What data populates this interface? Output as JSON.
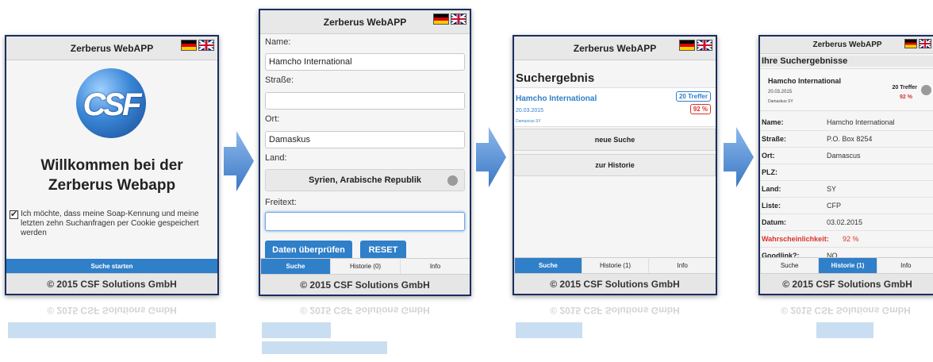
{
  "app": {
    "title": "Zerberus WebAPP",
    "copyright": "© 2015 CSF Solutions GmbH",
    "brand_color": "#2f7fc9",
    "frame_color": "#1b2f5e"
  },
  "screen1": {
    "logo_text": "CSF",
    "welcome": "Willkommen bei der Zerberus Webapp",
    "consent_text": "Ich möchte, dass meine Soap-Kennung und meine letzten zehn Suchanfragen per Cookie gespeichert werden",
    "consent_checked": true,
    "start_button": "Suche starten"
  },
  "screen2": {
    "fields": [
      {
        "label": "Name:",
        "value": "Hamcho International"
      },
      {
        "label": "Straße:",
        "value": ""
      },
      {
        "label": "Ort:",
        "value": "Damaskus"
      },
      {
        "label": "Land:",
        "value": "Syrien, Arabische Republik"
      },
      {
        "label": "Freitext:",
        "value": ""
      }
    ],
    "check_button": "Daten überprüfen",
    "reset_button": "RESET",
    "tabs": [
      "Suche",
      "Historie (0)",
      "Info"
    ]
  },
  "screen3": {
    "heading": "Suchergebnis",
    "result": {
      "name": "Hamcho International",
      "date": "20.03.2015",
      "location": "Damascus SY",
      "hits": "20 Treffer",
      "score": "92 %"
    },
    "new_search_button": "neue Suche",
    "history_button": "zur Historie",
    "tabs": [
      "Suche",
      "Historie (1)",
      "Info"
    ]
  },
  "screen4": {
    "heading": "Ihre Suchergebnisse",
    "summary": {
      "name": "Hamcho International",
      "date": "20.03.2015",
      "location": "Damaskus SY",
      "hits": "20 Treffer",
      "score": "92 %"
    },
    "details": [
      {
        "key": "Name:",
        "value": "Hamcho International"
      },
      {
        "key": "Straße:",
        "value": "P.O. Box 8254"
      },
      {
        "key": "Ort:",
        "value": "Damascus"
      },
      {
        "key": "PLZ:",
        "value": ""
      },
      {
        "key": "Land:",
        "value": "SY"
      },
      {
        "key": "Liste:",
        "value": "CFP"
      },
      {
        "key": "Datum:",
        "value": "03.02.2015"
      },
      {
        "key": "Wahrscheinlichkeit:",
        "value": "92 %"
      },
      {
        "key": "Goodlink?:",
        "value": "NO"
      }
    ],
    "tabs": [
      "Suche",
      "Historie (1)",
      "Info"
    ]
  },
  "icons": [
    "flag-de-icon",
    "flag-uk-icon",
    "arrow-right-icon",
    "toggle-icon",
    "check-icon"
  ]
}
